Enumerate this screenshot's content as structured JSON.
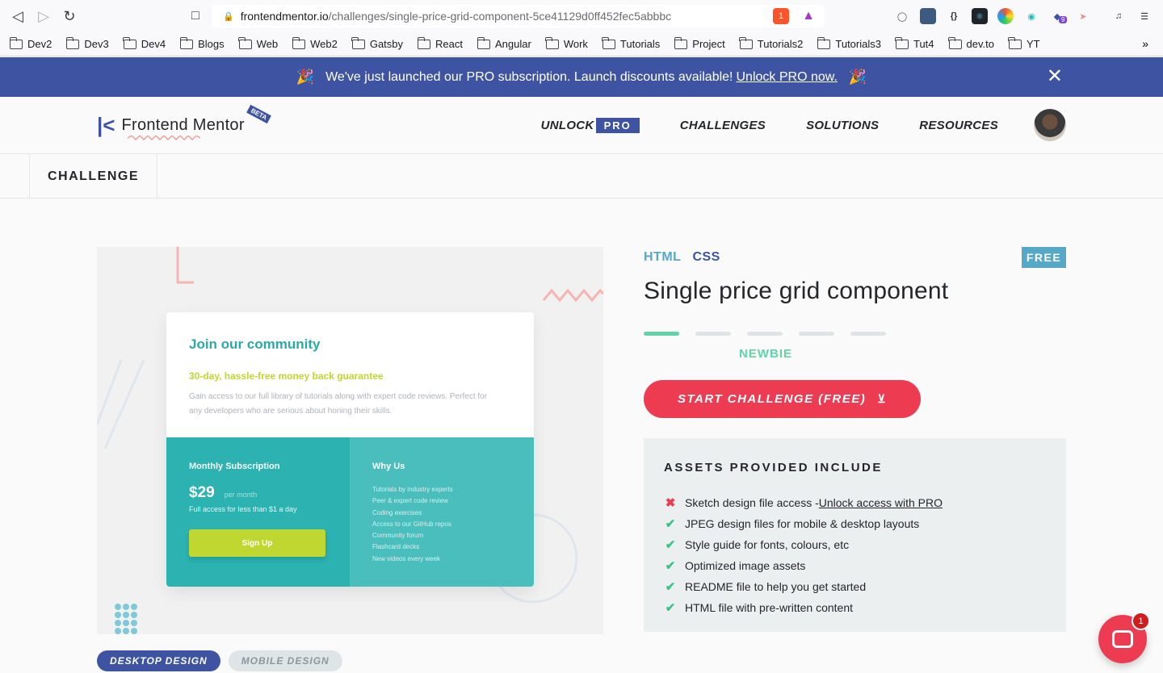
{
  "browser": {
    "url_host": "frontendmentor.io",
    "url_path": "/challenges/single-price-grid-component-5ce41129d0ff452fec5abbbc",
    "brave_badge": "1",
    "ext_badge": "9",
    "bookmarks": [
      "Dev2",
      "Dev3",
      "Dev4",
      "Blogs",
      "Web",
      "Web2",
      "Gatsby",
      "React",
      "Angular",
      "Work",
      "Tutorials",
      "Project",
      "Tutorials2",
      "Tutorials3",
      "Tut4",
      "dev.to",
      "YT"
    ],
    "overflow": "»"
  },
  "promo": {
    "text": "We've just launched our PRO subscription. Launch discounts available!",
    "link": "Unlock PRO now."
  },
  "header": {
    "logo_mark": "|<",
    "logo_text": "Frontend Mentor",
    "beta": "BETA",
    "nav_unlock": "UNLOCK",
    "nav_pro": "PRO",
    "nav_challenges": "CHALLENGES",
    "nav_solutions": "SOLUTIONS",
    "nav_resources": "RESOURCES"
  },
  "subnav": {
    "tab": "CHALLENGE"
  },
  "preview": {
    "title": "Join our community",
    "subtitle": "30-day, hassle-free money back guarantee",
    "desc": "Gain access to our full library of tutorials along with expert code reviews. Perfect for any developers who are serious about honing their skills.",
    "monthly": "Monthly Subscription",
    "price": "$29",
    "per": "per month",
    "price_note": "Full access for less than $1 a day",
    "signup": "Sign Up",
    "why": "Why Us",
    "why_items": [
      "Tutorials by industry experts",
      "Peer & expert code review",
      "Coding exercises",
      "Access to our GitHub repos",
      "Community forum",
      "Flashcard decks",
      "New videos every week"
    ]
  },
  "challenge": {
    "tag_html": "HTML",
    "tag_css": "CSS",
    "free": "FREE",
    "title": "Single price grid component",
    "difficulty": "NEWBIE",
    "difficulty_level": 1,
    "start": "START CHALLENGE (FREE)",
    "assets_title": "ASSETS PROVIDED INCLUDE",
    "assets": [
      {
        "text": "Sketch design file access - ",
        "link": "Unlock access with PRO",
        "included": false
      },
      {
        "text": "JPEG design files for mobile & desktop layouts",
        "included": true
      },
      {
        "text": "Style guide for fonts, colours, etc",
        "included": true
      },
      {
        "text": "Optimized image assets",
        "included": true
      },
      {
        "text": "README file to help you get started",
        "included": true
      },
      {
        "text": "HTML file with pre-written content",
        "included": true
      }
    ]
  },
  "design_tabs": {
    "desktop": "DESKTOP DESIGN",
    "mobile": "MOBILE DESIGN"
  },
  "chat": {
    "badge": "1"
  }
}
